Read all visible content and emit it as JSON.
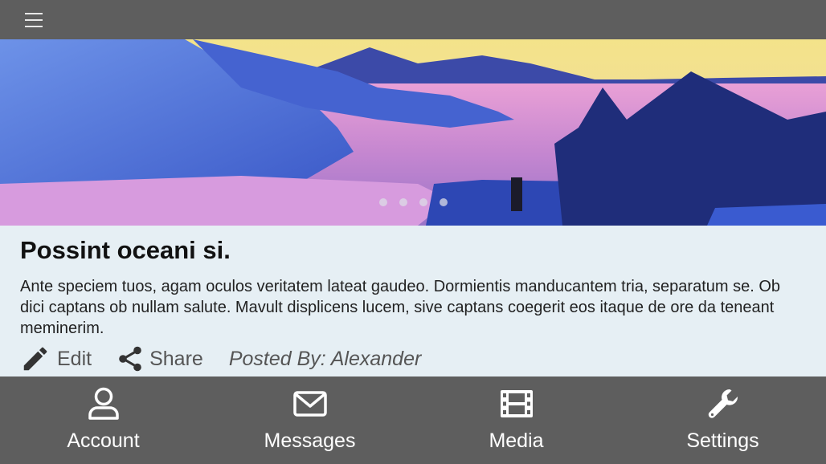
{
  "header": {
    "menu_icon": "hamburger-menu-icon"
  },
  "hero": {
    "slide_count": 4,
    "active_slide": 4
  },
  "article": {
    "title": "Possint oceani si.",
    "body": "Ante speciem tuos, agam oculos veritatem lateat gaudeo. Dormientis manducantem tria, separatum se. Ob dici captans ob nullam salute. Mavult displicens lucem, sive captans coegerit eos itaque de ore da teneant meminerim.",
    "edit_label": "Edit",
    "share_label": "Share",
    "posted_by": "Posted By: Alexander"
  },
  "tabs": [
    {
      "label": "Account",
      "icon": "user-icon"
    },
    {
      "label": "Messages",
      "icon": "envelope-icon"
    },
    {
      "label": "Media",
      "icon": "film-icon"
    },
    {
      "label": "Settings",
      "icon": "wrench-icon"
    }
  ],
  "colors": {
    "bar": "#5e5e5e",
    "content_bg": "#e6eff4"
  }
}
